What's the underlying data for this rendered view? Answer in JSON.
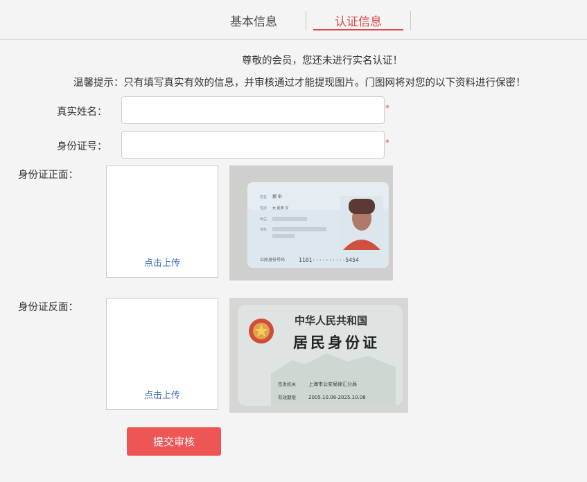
{
  "tabs": [
    {
      "label": "基本信息",
      "active": false
    },
    {
      "label": "认证信息",
      "active": true
    }
  ],
  "notice": {
    "line1": "尊敬的会员，您还未进行实名认证！",
    "line2": "温馨提示：只有填写真实有效的信息，并审核通过才能提现图片。门图网将对您的以下资料进行保密！"
  },
  "form": {
    "name_label": "真实姓名：",
    "name_value": "",
    "id_label": "身份证号：",
    "id_value": "",
    "required_mark": "*",
    "front_label": "身份证正面：",
    "back_label": "身份证反面：",
    "upload_label": "点击上传",
    "submit_label": "提交审核"
  },
  "front_sample": {
    "labels": [
      "姓名",
      "性别",
      "出生",
      "住址"
    ],
    "values": [
      "郝 中",
      "女  民族 汉",
      "",
      ""
    ],
    "id_caption": "公民身份号码",
    "id_value": "1101··········5454"
  },
  "back_sample": {
    "country": "中华人民共和国",
    "card_title": "居民身份证",
    "authority_label": "签发机关",
    "authority_value": "上海市公安局徐汇分局",
    "validity_label": "有效期限",
    "validity_value": "2005.10.08-2025.10.08"
  },
  "colors": {
    "accent": "#e0474b",
    "button": "#ee5656",
    "link": "#3b6fb6"
  }
}
